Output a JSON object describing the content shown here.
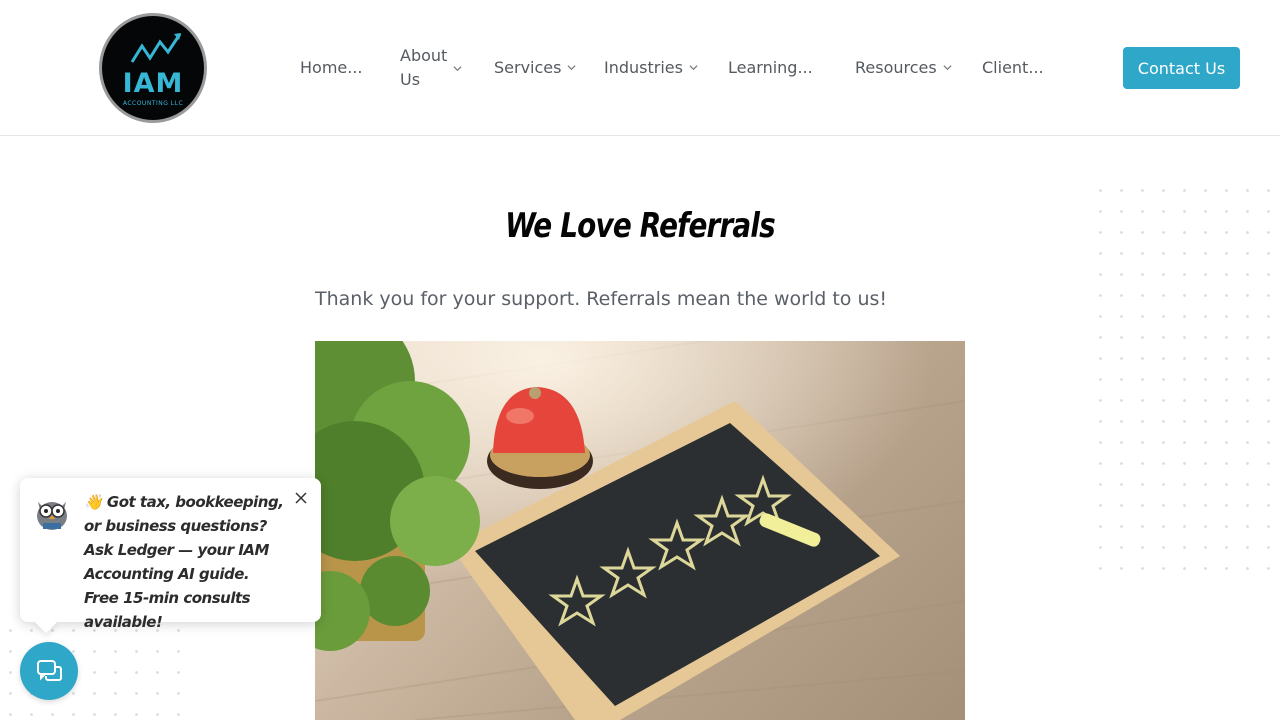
{
  "logo": {
    "text": "IAM",
    "subtext": "ACCOUNTING LLC"
  },
  "nav": {
    "items": [
      {
        "label": "Home...",
        "has_dropdown": false
      },
      {
        "label_line1": "About",
        "label_line2": "Us",
        "has_dropdown": true
      },
      {
        "label": "Services",
        "has_dropdown": true
      },
      {
        "label": "Industries",
        "has_dropdown": true
      },
      {
        "label": "Learning...",
        "has_dropdown": false
      },
      {
        "label": "Resources",
        "has_dropdown": true
      },
      {
        "label": "Client...",
        "has_dropdown": false
      }
    ],
    "contact_label": "Contact Us"
  },
  "main": {
    "title": "We Love Referrals",
    "subtitle": "Thank you for your support. Referrals mean the world to us!"
  },
  "chat": {
    "message": "👋 Got tax, bookkeeping, or business questions? Ask Ledger — your IAM Accounting AI guide. Free 15-min consults available!"
  },
  "colors": {
    "accent": "#2fa7c9",
    "logo_bg": "#050607",
    "logo_text": "#37b7d6",
    "nav_text": "#555a60",
    "title": "#050505"
  },
  "icons": {
    "chevron": "chevron-down-icon",
    "close": "close-icon",
    "chat": "chat-bubbles-icon",
    "avatar": "owl-avatar-icon"
  }
}
